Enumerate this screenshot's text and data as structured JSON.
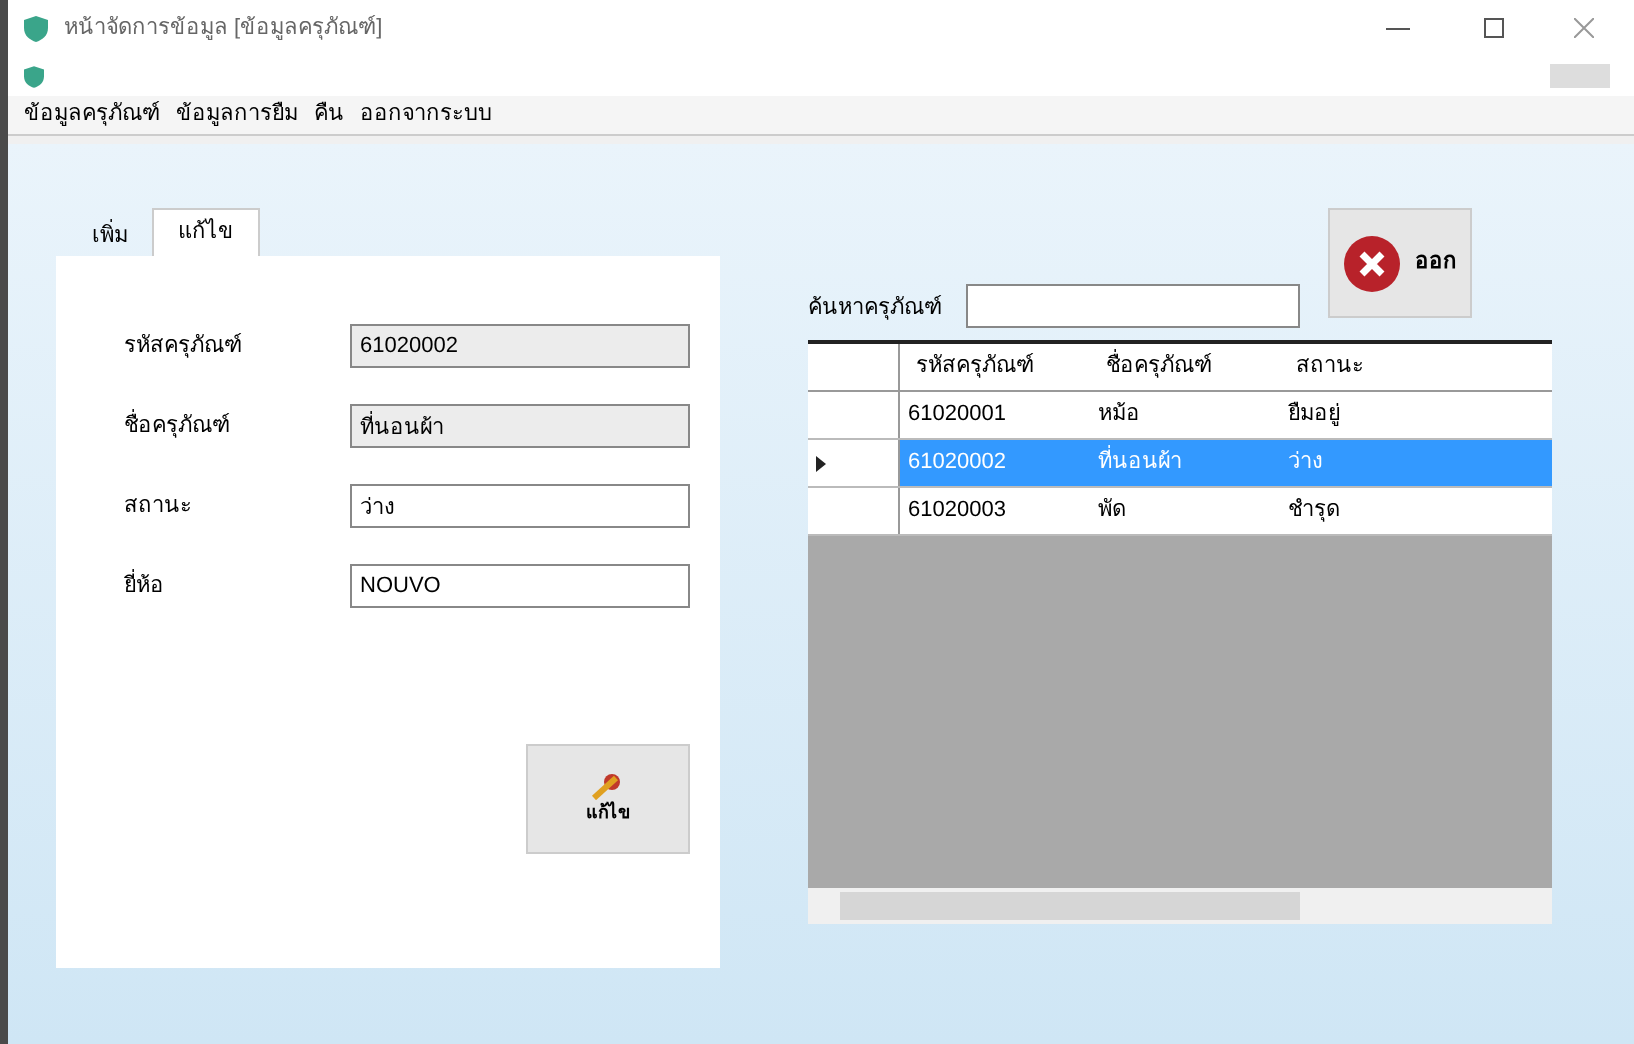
{
  "window": {
    "title": "หน้าจัดการข้อมูล [ข้อมูลครุภัณฑ์]"
  },
  "menu": [
    "ข้อมูลครุภัณฑ์",
    "ข้อมูลการยืม",
    "คืน",
    "ออกจากระบบ"
  ],
  "tabs": [
    {
      "label": "เพิ่ม",
      "selected": false
    },
    {
      "label": "แก้ไข",
      "selected": true
    }
  ],
  "form": {
    "fields": [
      {
        "label": "รหัสครุภัณฑ์",
        "value": "61020002",
        "disabled": true
      },
      {
        "label": "ชื่อครุภัณฑ์",
        "value": "ที่นอนผ้า",
        "disabled": true
      },
      {
        "label": "สถานะ",
        "value": "ว่าง",
        "disabled": false
      },
      {
        "label": "ยี่ห้อ",
        "value": "NOUVO",
        "disabled": false
      }
    ],
    "button": "แก้ไข"
  },
  "search": {
    "label": "ค้นหาครุภัณฑ์"
  },
  "close_button": "ออก",
  "table": {
    "columns": [
      "รหัสครุภัณฑ์",
      "ชื่อครุภัณฑ์",
      "สถานะ"
    ],
    "rows": [
      {
        "cells": [
          "61020001",
          "หม้อ",
          "ยืมอยู่"
        ],
        "selected": false
      },
      {
        "cells": [
          "61020002",
          "ที่นอนผ้า",
          "ว่าง"
        ],
        "selected": true
      },
      {
        "cells": [
          "61020003",
          "พัด",
          "ชำรุด"
        ],
        "selected": false
      }
    ]
  }
}
